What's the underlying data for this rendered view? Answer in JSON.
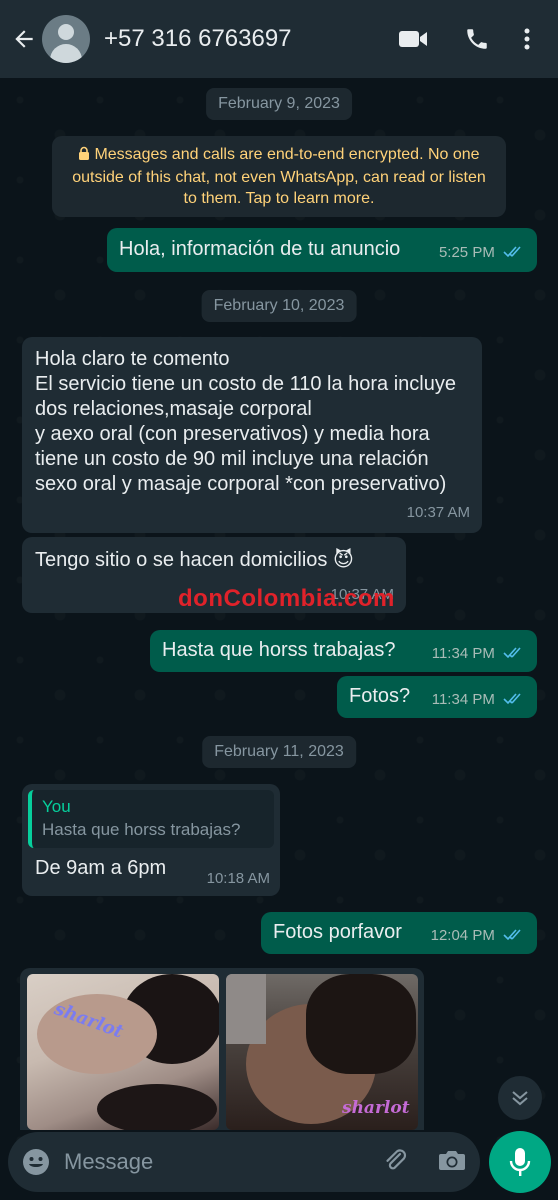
{
  "header": {
    "contact_name": "+57 316 6763697",
    "icons": [
      "back-arrow-icon",
      "avatar",
      "video-call-icon",
      "phone-call-icon",
      "more-options-icon"
    ]
  },
  "dates": {
    "first": "February 9, 2023",
    "second": "February 10, 2023",
    "third": "February 11, 2023"
  },
  "encryption_notice": "Messages and calls are end-to-end encrypted. No one outside of this chat, not even WhatsApp, can read or listen to them. Tap to learn more.",
  "messages": [
    {
      "direction": "out",
      "text": "Hola, información de tu anuncio",
      "time": "5:25 PM"
    },
    {
      "direction": "in",
      "text": "Hola claro te comento\nEl servicio tiene un costo de 110 la hora incluye dos relaciones,masaje corporal\ny aexo oral (con preservativos) y media hora tiene un costo de 90 mil incluye una relación sexo oral y masaje corporal *con preservativo)",
      "time": "10:37 AM"
    },
    {
      "direction": "in",
      "text": "Tengo sitio o se hacen domicilios 😈",
      "time": "10:37 AM"
    },
    {
      "direction": "out",
      "text": "Hasta que horss trabajas?",
      "time": "11:34 PM"
    },
    {
      "direction": "out",
      "text": "Fotos?",
      "time": "11:34 PM"
    },
    {
      "direction": "in",
      "quote_author": "You",
      "quote_text": "Hasta que horss trabajas?",
      "text": "De 9am a 6pm",
      "time": "10:18 AM"
    },
    {
      "direction": "out",
      "text": "Fotos porfavor",
      "time": "12:04 PM"
    }
  ],
  "photos": {
    "left_caption": "sharlot",
    "right_caption": "sharlot"
  },
  "watermark": {
    "part1": "donCo",
    "part2": "lombia",
    "part3": ".com"
  },
  "composer": {
    "placeholder": "Message",
    "icons": [
      "emoji-icon",
      "attach-icon",
      "camera-icon",
      "mic-icon"
    ]
  },
  "colors": {
    "header_bg": "#1f2c34",
    "outgoing_bubble": "#005c4b",
    "incoming_bubble": "#1f2c34",
    "read_ticks": "#53bdeb",
    "accent": "#00a884",
    "notice_text": "#ffd279"
  }
}
